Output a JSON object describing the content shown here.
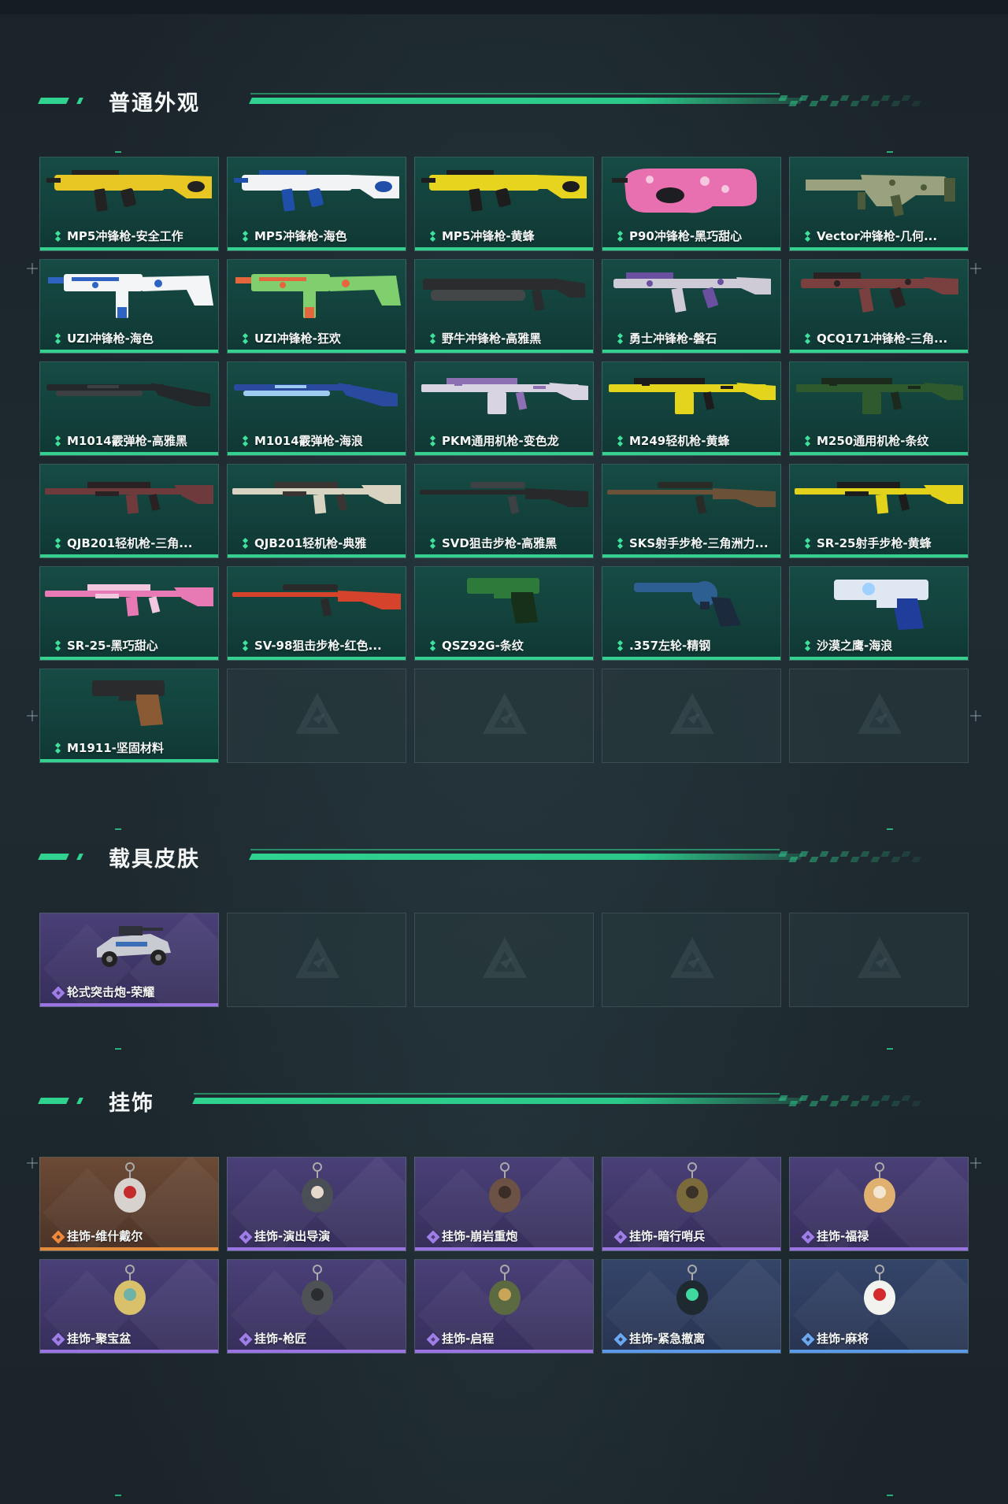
{
  "sections": {
    "skins": {
      "title": "普通外观"
    },
    "vehicles": {
      "title": "载具皮肤"
    },
    "pendants": {
      "title": "挂饰"
    }
  },
  "skins": [
    {
      "label": "MP5冲锋枪-安全工作",
      "kind": "smg",
      "color": "#e8c623",
      "accent": "#222222"
    },
    {
      "label": "MP5冲锋枪-海色",
      "kind": "smg",
      "color": "#f1f3f5",
      "accent": "#1f4fa8"
    },
    {
      "label": "MP5冲锋枪-黄蜂",
      "kind": "smg",
      "color": "#e6d41e",
      "accent": "#1d1d1d"
    },
    {
      "label": "P90冲锋枪-黑巧甜心",
      "kind": "p90",
      "color": "#e86fb0",
      "accent": "#f6c8df"
    },
    {
      "label": "Vector冲锋枪-几何...",
      "kind": "vector",
      "color": "#9aa17e",
      "accent": "#4d5a3a"
    },
    {
      "label": "UZI冲锋枪-海色",
      "kind": "uzi",
      "color": "#f4f5f6",
      "accent": "#2e63c3"
    },
    {
      "label": "UZI冲锋枪-狂欢",
      "kind": "uzi",
      "color": "#7fcf6e",
      "accent": "#e5653d"
    },
    {
      "label": "野牛冲锋枪-高雅黑",
      "kind": "bizon",
      "color": "#2a2c2e",
      "accent": "#444748"
    },
    {
      "label": "勇士冲锋枪-磐石",
      "kind": "smg2",
      "color": "#cfcbd6",
      "accent": "#6b4fa0"
    },
    {
      "label": "QCQ171冲锋枪-三角...",
      "kind": "smg2",
      "color": "#7a3f3f",
      "accent": "#2b2223"
    },
    {
      "label": "M1014霰弹枪-高雅黑",
      "kind": "shotgun",
      "color": "#25282a",
      "accent": "#3d4042"
    },
    {
      "label": "M1014霰弹枪-海浪",
      "kind": "shotgun",
      "color": "#2a4aa0",
      "accent": "#9ecbf0"
    },
    {
      "label": "PKM通用机枪-变色龙",
      "kind": "lmg",
      "color": "#d9d4e2",
      "accent": "#8d6fb3"
    },
    {
      "label": "M249轻机枪-黄蜂",
      "kind": "lmg",
      "color": "#e3d51c",
      "accent": "#1c1c1c"
    },
    {
      "label": "M250通用机枪-条纹",
      "kind": "lmg",
      "color": "#2e5a2e",
      "accent": "#1c2a1c"
    },
    {
      "label": "QJB201轻机枪-三角...",
      "kind": "rifle",
      "color": "#6e3a3c",
      "accent": "#2a2122"
    },
    {
      "label": "QJB201轻机枪-典雅",
      "kind": "rifle",
      "color": "#d9d3c2",
      "accent": "#3a3532"
    },
    {
      "label": "SVD狙击步枪-高雅黑",
      "kind": "sniper",
      "color": "#27292b",
      "accent": "#3e4144"
    },
    {
      "label": "SKS射手步枪-三角洲力...",
      "kind": "sniper",
      "color": "#6b5138",
      "accent": "#2a2a26"
    },
    {
      "label": "SR-25射手步枪-黄蜂",
      "kind": "rifle",
      "color": "#e2d21c",
      "accent": "#1c1c1c"
    },
    {
      "label": "SR-25-黑巧甜心",
      "kind": "rifle",
      "color": "#e77ab4",
      "accent": "#f3c7df"
    },
    {
      "label": "SV-98狙击步枪-红色...",
      "kind": "sniper",
      "color": "#d5432c",
      "accent": "#2a2a2a"
    },
    {
      "label": "QSZ92G-条纹",
      "kind": "pistol",
      "color": "#2e7a3a",
      "accent": "#16301a"
    },
    {
      "label": ".357左轮-精钢",
      "kind": "revolver",
      "color": "#2d5f93",
      "accent": "#1b2b3d"
    },
    {
      "label": "沙漠之鹰-海浪",
      "kind": "deagle",
      "color": "#dfe7f2",
      "accent": "#1f3e9c"
    },
    {
      "label": "M1911-坚固材料",
      "kind": "pistol",
      "color": "#2a2b2d",
      "accent": "#8a5a35"
    }
  ],
  "vehicles": [
    {
      "label": "轮式突击炮-荣耀",
      "color": "#c8ccd2",
      "accent": "#2e3238"
    }
  ],
  "pendants": [
    {
      "label": "挂饰-维什戴尔",
      "rarity": "orange",
      "color": "#d8d2cf",
      "accent": "#c42b2b"
    },
    {
      "label": "挂饰-演出导演",
      "rarity": "purple",
      "color": "#4a4e55",
      "accent": "#e6d9cc"
    },
    {
      "label": "挂饰-崩岩重炮",
      "rarity": "purple",
      "color": "#6b5244",
      "accent": "#3a2d26"
    },
    {
      "label": "挂饰-暗行哨兵",
      "rarity": "purple",
      "color": "#7a6a3c",
      "accent": "#3a3228"
    },
    {
      "label": "挂饰-福禄",
      "rarity": "purple",
      "color": "#e0b070",
      "accent": "#f2e6d2"
    },
    {
      "label": "挂饰-聚宝盆",
      "rarity": "purple",
      "color": "#d9c06a",
      "accent": "#6fb2a8"
    },
    {
      "label": "挂饰-枪匠",
      "rarity": "purple",
      "color": "#4e5257",
      "accent": "#2a2c30"
    },
    {
      "label": "挂饰-启程",
      "rarity": "purple",
      "color": "#5b6a40",
      "accent": "#c9a55a"
    },
    {
      "label": "挂饰-紧急撤离",
      "rarity": "blue",
      "color": "#1e2a30",
      "accent": "#3fd9a0"
    },
    {
      "label": "挂饰-麻将",
      "rarity": "blue",
      "color": "#f2f2ee",
      "accent": "#d32b2b"
    }
  ],
  "colors": {
    "accent_green": "#2fd28f",
    "purple_line": "#9a74e0",
    "orange_line": "#e08a3a",
    "blue_line": "#5a9ae6"
  }
}
